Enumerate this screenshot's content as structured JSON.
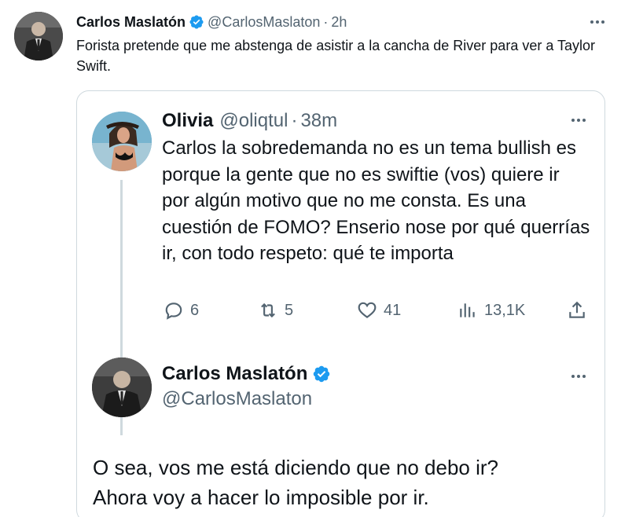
{
  "outer_tweet": {
    "display_name": "Carlos Maslatón",
    "handle": "@CarlosMaslaton",
    "separator": "·",
    "time": "2h",
    "text": "Forista pretende que me abstenga de asistir a la cancha de River para ver a Taylor Swift."
  },
  "quoted_tweet": {
    "display_name": "Olivia",
    "handle": "@oliqtul",
    "separator": "·",
    "time": "38m",
    "text": "Carlos la sobredemanda no es un tema bullish es porque la gente que no es swiftie (vos) quiere ir por algún motivo que no me consta. Es una cuestión de FOMO? Enserio nose por qué querrías ir, con todo respeto: qué te importa",
    "actions": {
      "replies": "6",
      "retweets": "5",
      "likes": "41",
      "views": "13,1K"
    }
  },
  "reply_tweet": {
    "display_name": "Carlos Maslatón",
    "handle": "@CarlosMaslaton",
    "text_line1": "O sea, vos me está diciendo que no debo ir?",
    "text_line2": "Ahora voy a hacer lo imposible por ir."
  },
  "icons": {
    "verified": "verified-badge-icon",
    "more": "more-icon",
    "reply": "reply-icon",
    "retweet": "retweet-icon",
    "like": "heart-icon",
    "views": "views-icon",
    "share": "share-icon"
  },
  "colors": {
    "text_primary": "#0f1419",
    "text_secondary": "#536471",
    "verified_blue": "#1d9bf0",
    "border": "#cfd9de"
  }
}
